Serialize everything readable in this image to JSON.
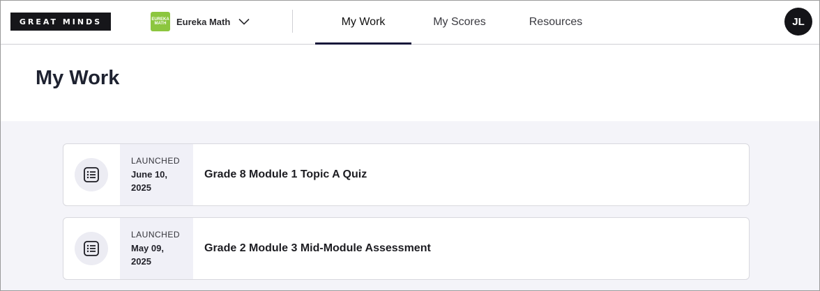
{
  "header": {
    "logo_text": "GREAT MINDS",
    "product": {
      "badge_line1": "EUREKA",
      "badge_line2": "MATH",
      "name": "Eureka Math",
      "icon": "chevron-down-icon"
    },
    "tabs": [
      {
        "label": "My Work",
        "active": true
      },
      {
        "label": "My Scores",
        "active": false
      },
      {
        "label": "Resources",
        "active": false
      }
    ],
    "avatar_initials": "JL"
  },
  "page": {
    "title": "My Work"
  },
  "assignments": [
    {
      "status_label": "LAUNCHED",
      "date_line1": "June 10,",
      "date_line2": "2025",
      "title": "Grade 8 Module 1 Topic A Quiz",
      "icon": "list-icon"
    },
    {
      "status_label": "LAUNCHED",
      "date_line1": "May 09,",
      "date_line2": "2025",
      "title": "Grade 2 Module 3 Mid-Module Assessment",
      "icon": "list-icon"
    }
  ],
  "colors": {
    "accent": "#16163a",
    "brand_green": "#8cc63f",
    "content_bg": "#f4f4f9"
  }
}
